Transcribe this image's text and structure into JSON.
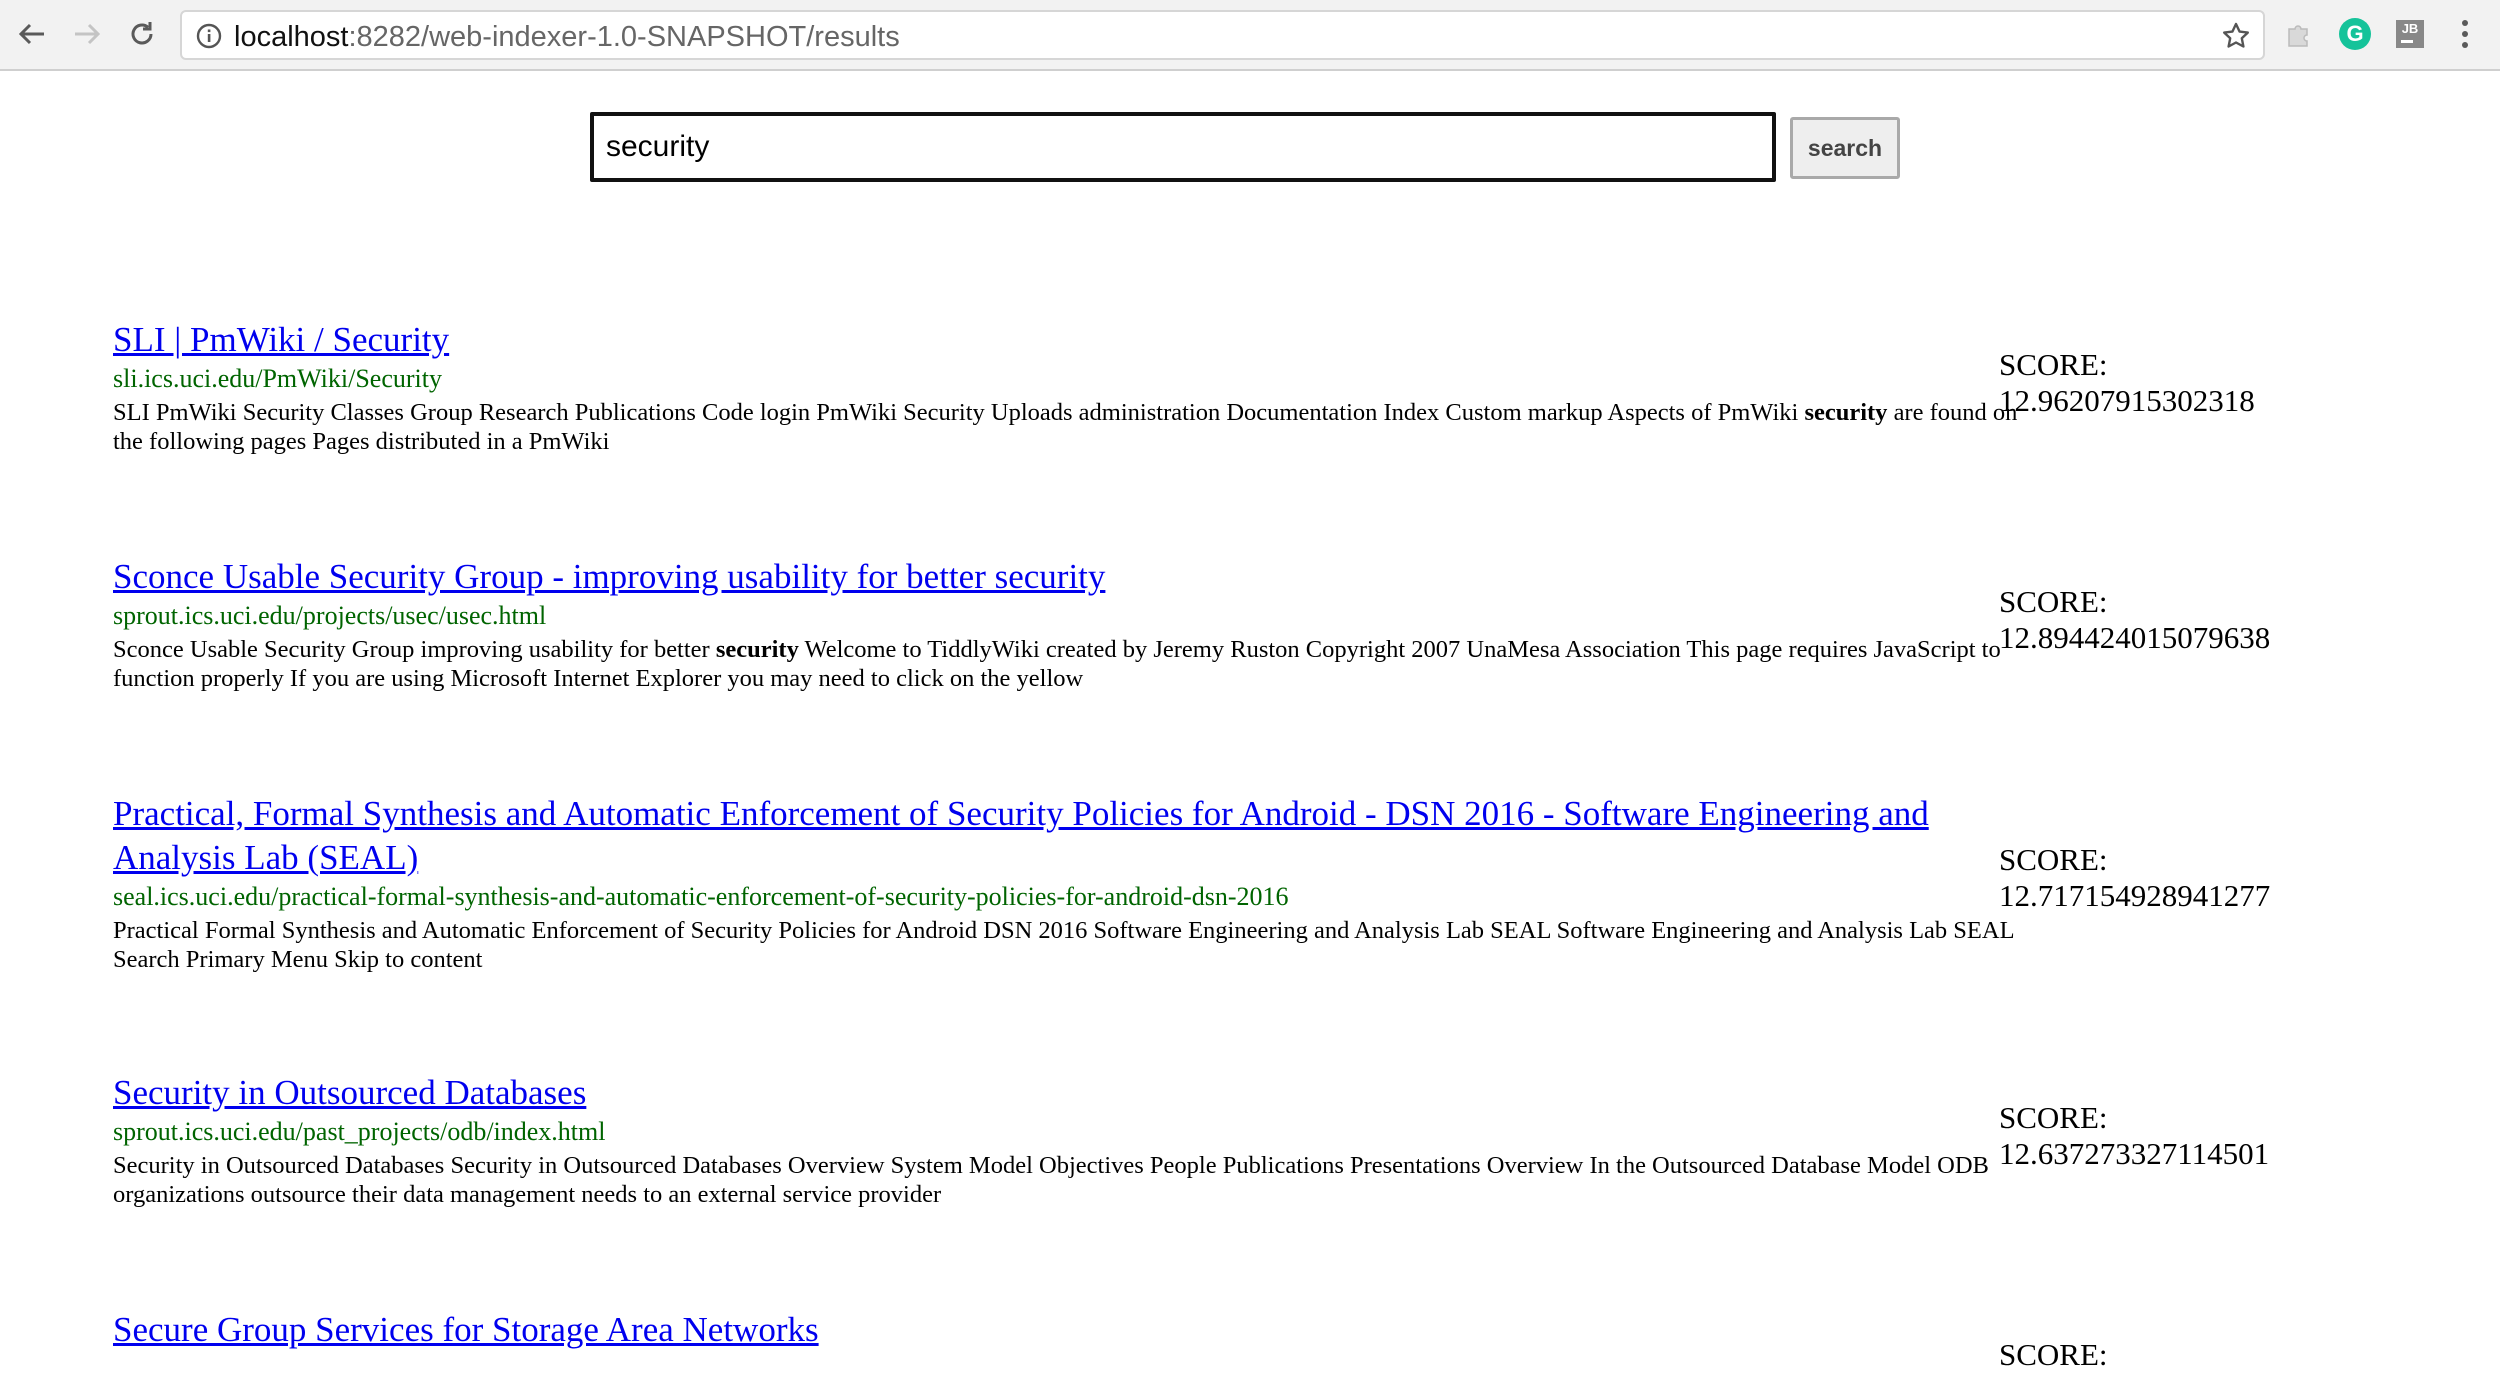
{
  "browser": {
    "url_host": "localhost",
    "url_path": ":8282/web-indexer-1.0-SNAPSHOT/results",
    "extensions": {
      "grammarly_label": "G",
      "jb_label": "JB"
    }
  },
  "search": {
    "query": "security",
    "button_label": "search"
  },
  "results": [
    {
      "title": "SLI | PmWiki / Security",
      "url": "sli.ics.uci.edu/PmWiki/Security",
      "snippet_before": "SLI PmWiki Security Classes Group Research Publications Code login PmWiki Security Uploads administration Documentation Index Custom markup Aspects of PmWiki ",
      "snippet_bold": "security",
      "snippet_after": " are found on the following pages Pages distributed in a PmWiki",
      "score_label": "SCORE:",
      "score": "12.96207915302318"
    },
    {
      "title": "Sconce Usable Security Group - improving usability for better security",
      "url": "sprout.ics.uci.edu/projects/usec/usec.html",
      "snippet_before": "Sconce Usable Security Group improving usability for better ",
      "snippet_bold": "security",
      "snippet_after": " Welcome to TiddlyWiki created by Jeremy Ruston Copyright 2007 UnaMesa Association This page requires JavaScript to function properly If you are using Microsoft Internet Explorer you may need to click on the yellow",
      "score_label": "SCORE:",
      "score": "12.894424015079638"
    },
    {
      "title": "Practical, Formal Synthesis and Automatic Enforcement of Security Policies for Android - DSN 2016 - Software Engineering and Analysis Lab (SEAL)",
      "url": "seal.ics.uci.edu/practical-formal-synthesis-and-automatic-enforcement-of-security-policies-for-android-dsn-2016",
      "snippet_before": "Practical Formal Synthesis and Automatic Enforcement of Security Policies for Android DSN 2016 Software Engineering and Analysis Lab SEAL Software Engineering and Analysis Lab SEAL Search Primary Menu Skip to content",
      "snippet_bold": "",
      "snippet_after": "",
      "score_label": "SCORE:",
      "score": "12.717154928941277"
    },
    {
      "title": "Security in Outsourced Databases",
      "url": "sprout.ics.uci.edu/past_projects/odb/index.html",
      "snippet_before": "Security in Outsourced Databases Security in Outsourced Databases Overview System Model Objectives People Publications Presentations Overview In the Outsourced Database Model ODB organizations outsource their data management needs to an external service provider",
      "snippet_bold": "",
      "snippet_after": "",
      "score_label": "SCORE:",
      "score": "12.637273327114501"
    },
    {
      "title": "Secure Group Services for Storage Area Networks",
      "url": "",
      "snippet_before": "",
      "snippet_bold": "",
      "snippet_after": "",
      "score_label": "SCORE:",
      "score": ""
    }
  ]
}
